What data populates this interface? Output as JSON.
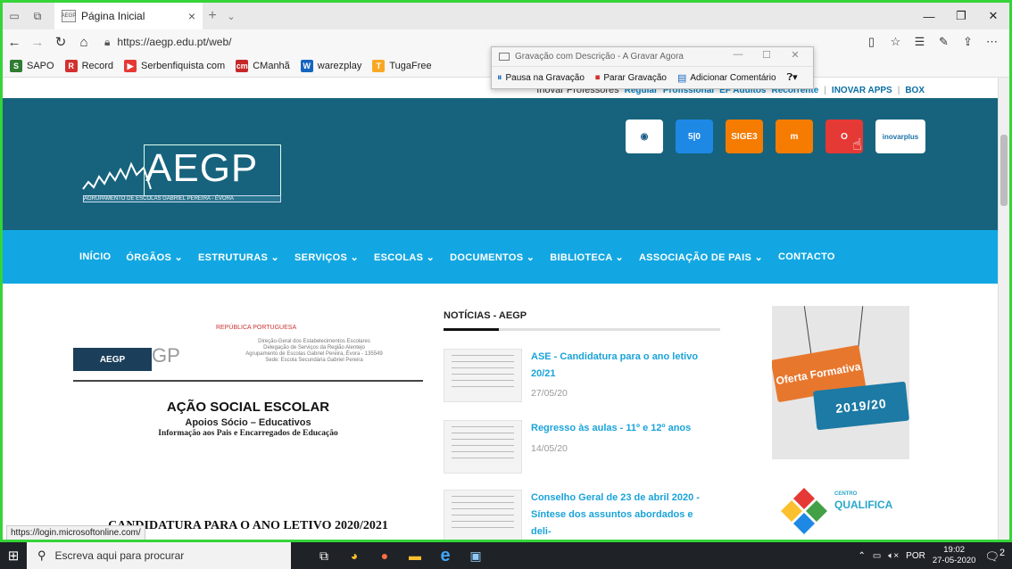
{
  "browser": {
    "tab_title": "Página Inicial",
    "tab_favicon_text": "AEGP",
    "tab_close": "×",
    "new_tab": "+",
    "tab_more": "⌄",
    "url": "https://aegp.edu.pt/web/",
    "status_url": "https://login.microsoftonline.com/"
  },
  "favorites": [
    {
      "label": "SAPO",
      "color": "#2e7d32",
      "icon": "S"
    },
    {
      "label": "Record",
      "color": "#d32f2f",
      "icon": "R"
    },
    {
      "label": "Serbenfiquista com",
      "color": "#e53935",
      "icon": "▶"
    },
    {
      "label": "CManhã",
      "color": "#c62828",
      "icon": "cm"
    },
    {
      "label": "warezplay",
      "color": "#1565c0",
      "icon": "W"
    },
    {
      "label": "TugaFree",
      "color": "#f9a825",
      "icon": "T"
    }
  ],
  "recorder": {
    "title": "Gravação com Descrição - A Gravar Agora",
    "pause": "Pausa na Gravação",
    "stop": "Parar Gravação",
    "comment": "Adicionar Comentário"
  },
  "site": {
    "top_links": [
      {
        "label": "Inovar Professores",
        "style": "gray"
      },
      {
        "label": "Regular",
        "style": ""
      },
      {
        "label": "Profissional",
        "style": ""
      },
      {
        "label": "EF Adultos",
        "style": ""
      },
      {
        "label": "Recorrente",
        "style": ""
      },
      {
        "label": "|",
        "style": "sep"
      },
      {
        "label": "INOVAR APPS",
        "style": "dark"
      },
      {
        "label": "|",
        "style": "sep"
      },
      {
        "label": "BOX",
        "style": "dark"
      }
    ],
    "logo_text": "AEGP",
    "logo_sub": "AGRUPAMENTO DE ESCOLAS GABRIEL PEREIRA - ÉVORA",
    "apps": [
      {
        "label": "",
        "color": "#fff",
        "text_color": "#1d5d8a",
        "glyph": "◉"
      },
      {
        "label": "5|0",
        "color": "#1e88e5",
        "text_color": "#fff",
        "glyph": "5|0"
      },
      {
        "label": "SIGE3",
        "color": "#f57c00",
        "text_color": "#fff",
        "glyph": "SIGE3"
      },
      {
        "label": "m",
        "color": "#f57c00",
        "text_color": "#fff",
        "glyph": "m"
      },
      {
        "label": "Office 365",
        "color": "#e53935",
        "text_color": "#fff",
        "glyph": "O"
      },
      {
        "label": "inovarplus",
        "color": "#fff",
        "text_color": "#1a73a8",
        "glyph": "inovarplus"
      }
    ],
    "nav": [
      "INÍCIO",
      "ÓRGÃOS ⌄",
      "ESTRUTURAS ⌄",
      "SERVIÇOS ⌄",
      "ESCOLAS ⌄",
      "DOCUMENTOS ⌄",
      "BIBLIOTECA ⌄",
      "ASSOCIAÇÃO DE PAIS ⌄",
      "CONTACTO"
    ]
  },
  "doc": {
    "aegp": "AEGP",
    "gp": "GP",
    "seal": "REPÚBLICA PORTUGUESA",
    "dg_lines": [
      "Direção-Geral dos Estabelecimentos Escolares",
      "Delegação de Serviços da Região Alentejo",
      "Agrupamento de Escolas Gabriel Pereira, Évora - 135549",
      "Sede: Escola Secundária Gabriel Pereira"
    ],
    "title": "AÇÃO SOCIAL ESCOLAR",
    "subtitle": "Apoios Sócio – Educativos",
    "info": "Informação aos Pais e Encarregados de Educação",
    "cand": "CANDIDATURA PARA O ANO LETIVO 2020/2021"
  },
  "news": {
    "heading": "NOTÍCIAS - AEGP",
    "items": [
      {
        "title": "ASE - Candidatura para o ano letivo 20/21",
        "date": "27/05/20"
      },
      {
        "title": "Regresso às aulas - 11º e 12º anos",
        "date": "14/05/20"
      },
      {
        "title": "Conselho Geral de 23 de abril 2020 - Síntese dos assuntos abordados e deli-",
        "date": ""
      }
    ]
  },
  "side": {
    "oferta": "Oferta Formativa",
    "year": "2019/20",
    "centro": "CENTRO",
    "qualifica": "QUALIFICA"
  },
  "taskbar": {
    "search": "Escreva aqui para procurar",
    "lang": "POR",
    "time": "19:02",
    "date": "27-05-2020",
    "notif": "2"
  }
}
